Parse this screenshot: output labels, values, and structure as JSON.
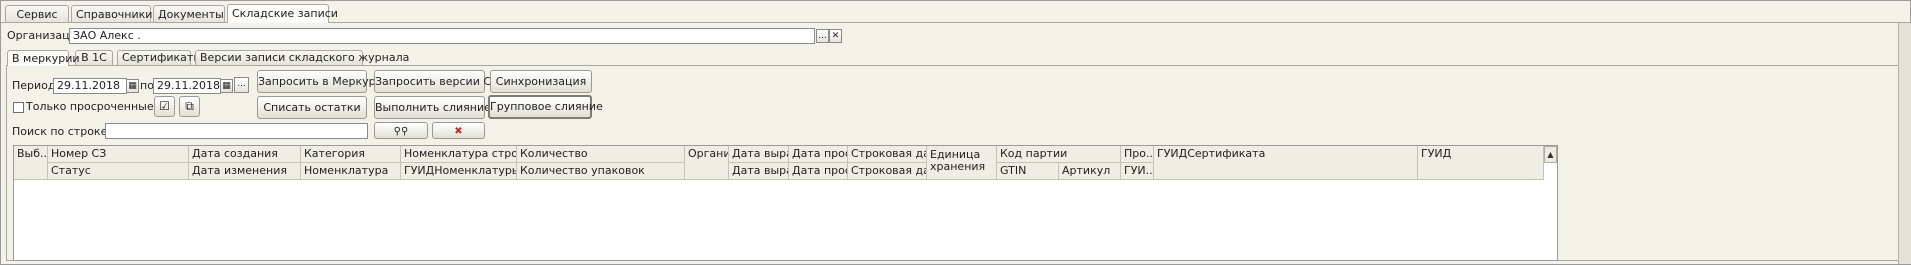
{
  "main_tabs": [
    "Сервис",
    "Справочники",
    "Документы",
    "Складские записи"
  ],
  "organization": {
    "label": "Организация:",
    "value": "ЗАО  Алекс                        .",
    "select_btn": "...",
    "clear_btn": "✕"
  },
  "sub_tabs": [
    "В меркурии",
    "В 1С",
    "Сертификаты",
    "Версии записи складского журнала"
  ],
  "filters": {
    "period_from_label": "Период с:",
    "period_from": "29.11.2018",
    "period_to_label": "по:",
    "period_to": "29.11.2018",
    "period_btn": "...",
    "only_overdue_label": "Только просроченные",
    "search_label": "Поиск по строке:",
    "search_value": ""
  },
  "buttons": {
    "request_mercury": "Запросить в Меркурии",
    "request_versions": "Запросить версии СЗ",
    "sync": "Синхронизация",
    "write_off": "Списать остатки",
    "merge": "Выполнить слияние",
    "group_merge": "Групповое слияние"
  },
  "grid": {
    "row1": [
      "Выб...",
      "Номер СЗ",
      "Дата создания",
      "Категория",
      "Номенклатура строкой",
      "Количество",
      "Органи...",
      "Дата выра...",
      "Дата прос...",
      "Строковая дат...",
      "Единица хранения",
      "Код партии",
      "Про...",
      "ГУИДСертификата",
      "ГУИД"
    ],
    "row2": [
      "Статус",
      "Дата изменения",
      "Номенклатура",
      "ГУИДНоменклатуры",
      "Количество упаковок",
      "Дата выра...",
      "Дата прос...",
      "Строковая дат...",
      "GTIN",
      "Артикул",
      "ГУИ..."
    ]
  },
  "colors": {
    "background": "#f3f2e9",
    "header_bg": "#efeee4",
    "border": "#a8a8a0"
  }
}
